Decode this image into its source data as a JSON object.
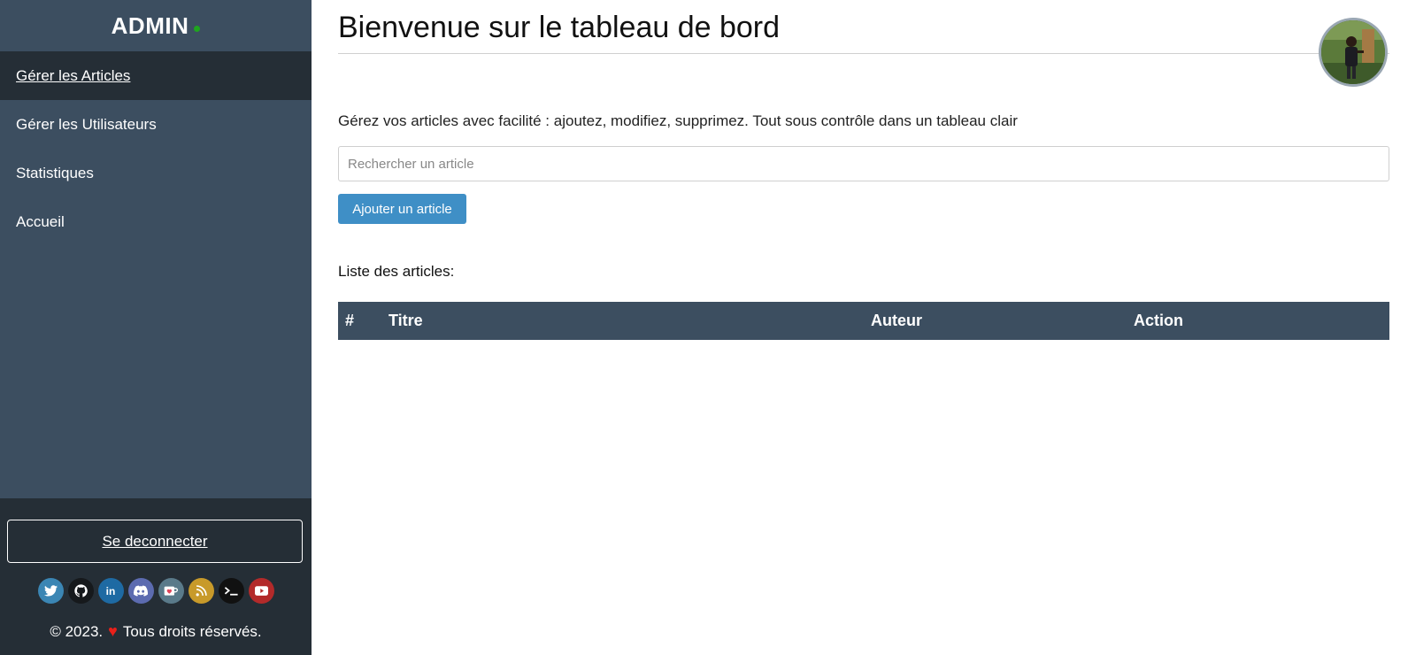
{
  "sidebar": {
    "brand": "ADMIN",
    "nav": [
      {
        "label": "Gérer les Articles",
        "active": true
      },
      {
        "label": "Gérer les Utilisateurs"
      },
      {
        "label": "Statistiques"
      },
      {
        "label": "Accueil"
      }
    ],
    "logout_label": "Se deconnecter",
    "socials": [
      {
        "icon": "twitter-icon",
        "color": "#3b86b4"
      },
      {
        "icon": "github-icon",
        "color": "#16191c"
      },
      {
        "icon": "linkedin-icon",
        "color": "#1e6aa3"
      },
      {
        "icon": "discord-icon",
        "color": "#5c6bb0"
      },
      {
        "icon": "kofi-icon",
        "color": "#5a7a8a"
      },
      {
        "icon": "rss-icon",
        "color": "#c89a2a"
      },
      {
        "icon": "terminal-icon",
        "color": "#111111"
      },
      {
        "icon": "youtube-icon",
        "color": "#b32a2a"
      }
    ],
    "copyright_prefix": "© 2023.",
    "copyright_suffix": "Tous droits réservés."
  },
  "main": {
    "title": "Bienvenue sur le tableau de bord",
    "intro": "Gérez vos articles avec facilité : ajoutez, modifiez, supprimez. Tout sous contrôle dans un tableau clair",
    "search_placeholder": "Rechercher un article",
    "add_button": "Ajouter un article",
    "list_title": "Liste des articles:",
    "table_headers": [
      "#",
      "Titre",
      "Auteur",
      "Action"
    ]
  },
  "colors": {
    "sidebar": "#3c4e60",
    "sidebar_dark": "#252e36",
    "accent": "#3f8fc6",
    "status_dot": "#1fa51f"
  }
}
